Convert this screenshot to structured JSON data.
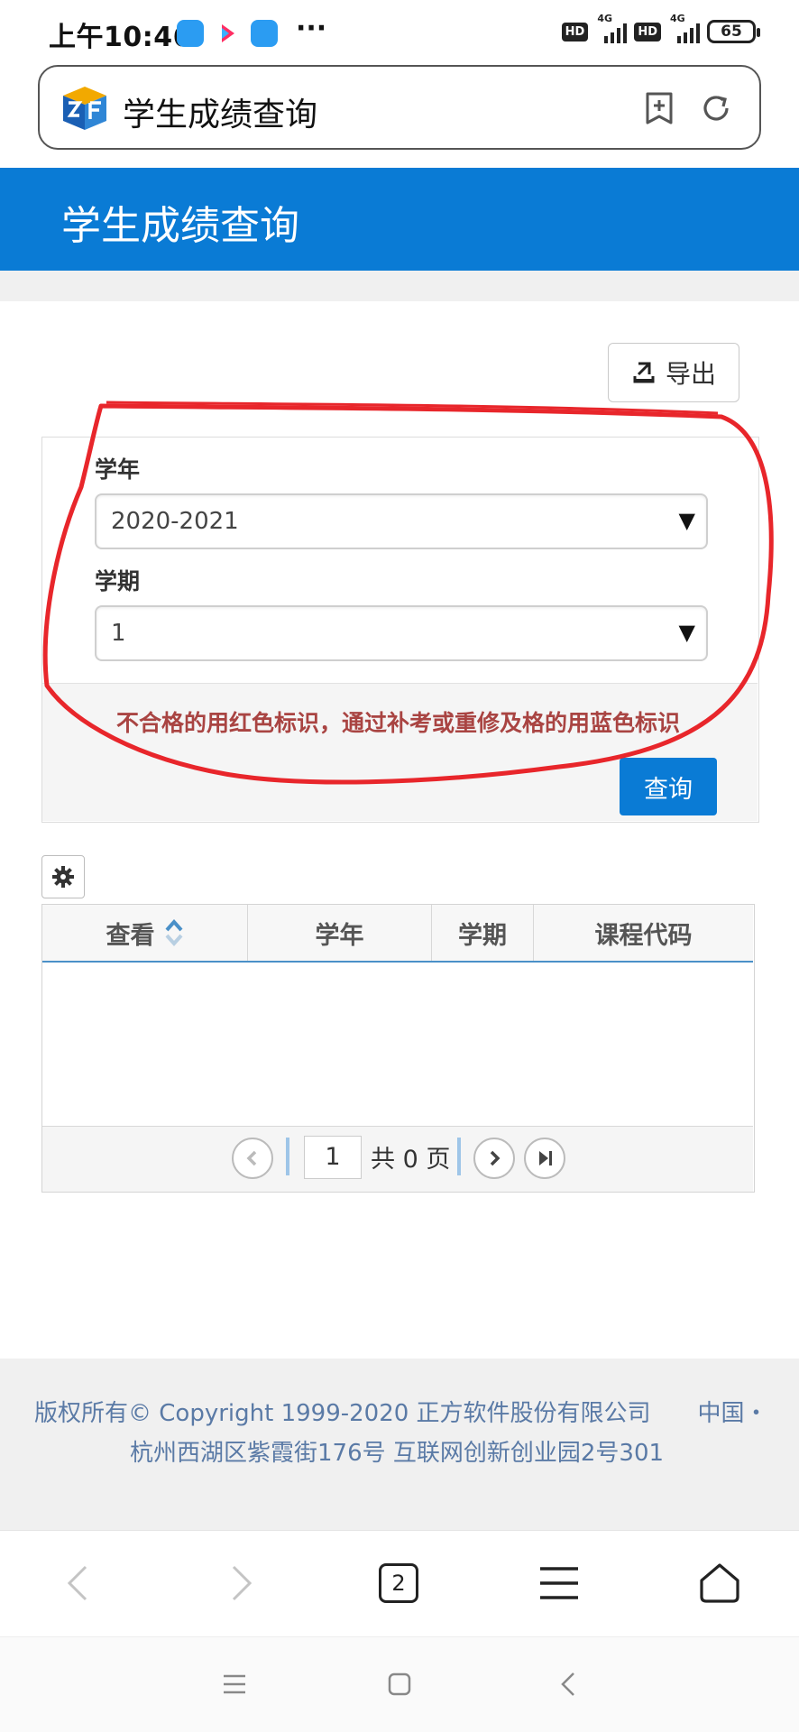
{
  "status_bar": {
    "time": "上午10:46",
    "more": "···",
    "hd": "HD",
    "net": "4G",
    "battery": "65"
  },
  "browser": {
    "title": "学生成绩查询",
    "tabs_count": "2"
  },
  "page": {
    "header_title": "学生成绩查询",
    "export_label": "导出",
    "year_label": "学年",
    "year_value": "2020-2021",
    "term_label": "学期",
    "term_value": "1",
    "notice": "不合格的用红色标识，通过补考或重修及格的用蓝色标识",
    "query_label": "查询"
  },
  "grid": {
    "columns": [
      "查看",
      "学年",
      "学期",
      "课程代码"
    ],
    "page_input": "1",
    "page_total": "共 0 页"
  },
  "footer": {
    "line1": "版权所有© Copyright 1999-2020 正方软件股份有限公司　　中国・",
    "line2": "杭州西湖区紫霞街176号 互联网创新创业园2号301"
  },
  "colors": {
    "brand": "#0a7bd5",
    "notice": "#a94442",
    "annotation": "#e8262b"
  }
}
